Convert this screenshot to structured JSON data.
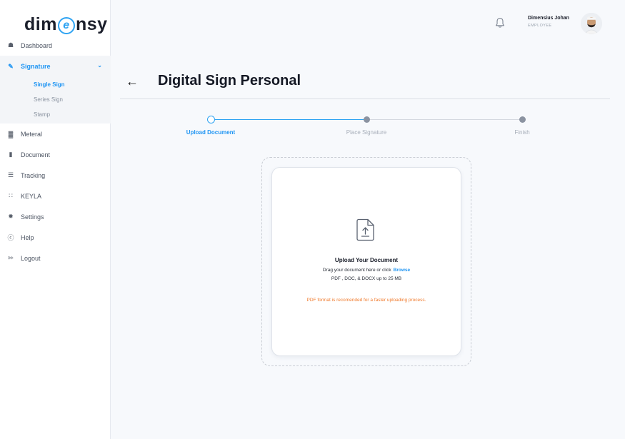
{
  "brand": {
    "logo_left": "dim",
    "logo_mid": "e",
    "logo_right": "nsy",
    "accent": "#2196f3"
  },
  "sidebar": {
    "items": [
      {
        "label": "Dashboard",
        "icon": "home-icon"
      },
      {
        "label": "Signature",
        "icon": "signature-icon",
        "active": true,
        "sub": [
          {
            "label": "Single Sign",
            "active": true
          },
          {
            "label": "Series Sign"
          },
          {
            "label": "Stamp"
          }
        ]
      },
      {
        "label": "Meteral",
        "icon": "stamp-icon"
      },
      {
        "label": "Document",
        "icon": "document-icon"
      },
      {
        "label": "Tracking",
        "icon": "list-icon"
      },
      {
        "label": "KEYLA",
        "icon": "grid-icon"
      },
      {
        "label": "Settings",
        "icon": "gear-icon"
      },
      {
        "label": "Help",
        "icon": "help-icon"
      },
      {
        "label": "Logout",
        "icon": "logout-icon"
      }
    ]
  },
  "header": {
    "user_name": "Dimensius Johan",
    "user_role": "EMPLOYEE"
  },
  "page": {
    "title": "Digital Sign Personal"
  },
  "stepper": {
    "steps": [
      {
        "label": "Upload Document",
        "state": "current"
      },
      {
        "label": "Place Signature",
        "state": "pending"
      },
      {
        "label": "Finish",
        "state": "pending"
      }
    ]
  },
  "upload": {
    "title": "Upload Your Document",
    "instruction": "Drag your document here or click",
    "browse_label": "Browse",
    "formats": "PDF , DOC, & DOCX up to 25 MB",
    "note": "PDF format is recomended for a faster uploading process.",
    "note_color": "#f07a2c"
  }
}
